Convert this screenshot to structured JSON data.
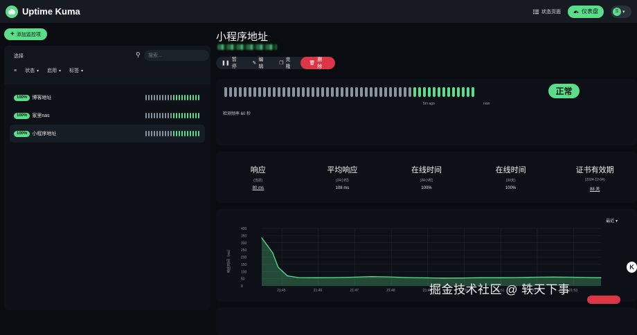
{
  "app": {
    "name": "Uptime Kuma",
    "status_page_label": "状态页面",
    "dashboard_label": "仪表盘",
    "avatar_letter": "S",
    "accent_color": "#5cdd8b",
    "danger_color": "#dc3545"
  },
  "sidebar": {
    "add_button": "添加监控项",
    "select_label": "选择",
    "search_placeholder": "搜索...",
    "filters": [
      "状态",
      "启用",
      "标签"
    ],
    "monitors": [
      {
        "name": "博客地址",
        "uptime": "100%",
        "beats_down": 10,
        "beats_up": 10,
        "active": false
      },
      {
        "name": "家里nas",
        "uptime": "100%",
        "beats_down": 10,
        "beats_up": 10,
        "active": false
      },
      {
        "name": "小程序地址",
        "uptime": "100%",
        "beats_down": 10,
        "beats_up": 10,
        "active": true
      }
    ]
  },
  "monitor": {
    "title": "小程序地址",
    "actions": {
      "pause": "暂停",
      "edit": "编辑",
      "clone": "克隆",
      "delete": "删除"
    },
    "heartbeat": {
      "beats_down": 39,
      "beats_up": 13,
      "ago_label": "5m ago",
      "now_label": "now",
      "interval_label": "检测频率 60 秒"
    },
    "status": "正常",
    "stats": [
      {
        "title": "响应",
        "sub": "(当前)",
        "value": "80 ms",
        "underline": true
      },
      {
        "title": "平均响应",
        "sub": "(24小时)",
        "value": "108 ms",
        "underline": false
      },
      {
        "title": "在线时间",
        "sub": "(24小时)",
        "value": "100%",
        "underline": false
      },
      {
        "title": "在线时间",
        "sub": "(30天)",
        "value": "100%",
        "underline": false
      },
      {
        "title": "证书有效期",
        "sub": "(2024-12-04)",
        "value": "88 天",
        "underline": true
      }
    ],
    "chart_period": "最近"
  },
  "chart_data": {
    "type": "area",
    "title": "",
    "xlabel": "",
    "ylabel": "响应时间（ms）",
    "ylim": [
      0,
      400
    ],
    "yticks": [
      0,
      50,
      100,
      150,
      200,
      250,
      300,
      350,
      400
    ],
    "xticks": [
      "21:45",
      "21:46",
      "21:47",
      "21:48",
      "21:49",
      "21:50",
      "21:51",
      "21:52",
      "21:53"
    ],
    "x": [
      0,
      0.3,
      0.45,
      0.7,
      1,
      1.5,
      2,
      2.5,
      3,
      3.5,
      4,
      4.5,
      5,
      5.5,
      6,
      6.5,
      7,
      7.5,
      8,
      8.5,
      9,
      9.3
    ],
    "y": [
      335,
      230,
      130,
      70,
      58,
      57,
      58,
      60,
      64,
      62,
      58,
      56,
      54,
      55,
      57,
      57,
      58,
      60,
      61,
      60,
      58,
      57
    ],
    "series_color": "#5cdd8b",
    "grid": true
  },
  "watermark": "掘金技术社区 @ 轶天下事",
  "help_badge": "K"
}
